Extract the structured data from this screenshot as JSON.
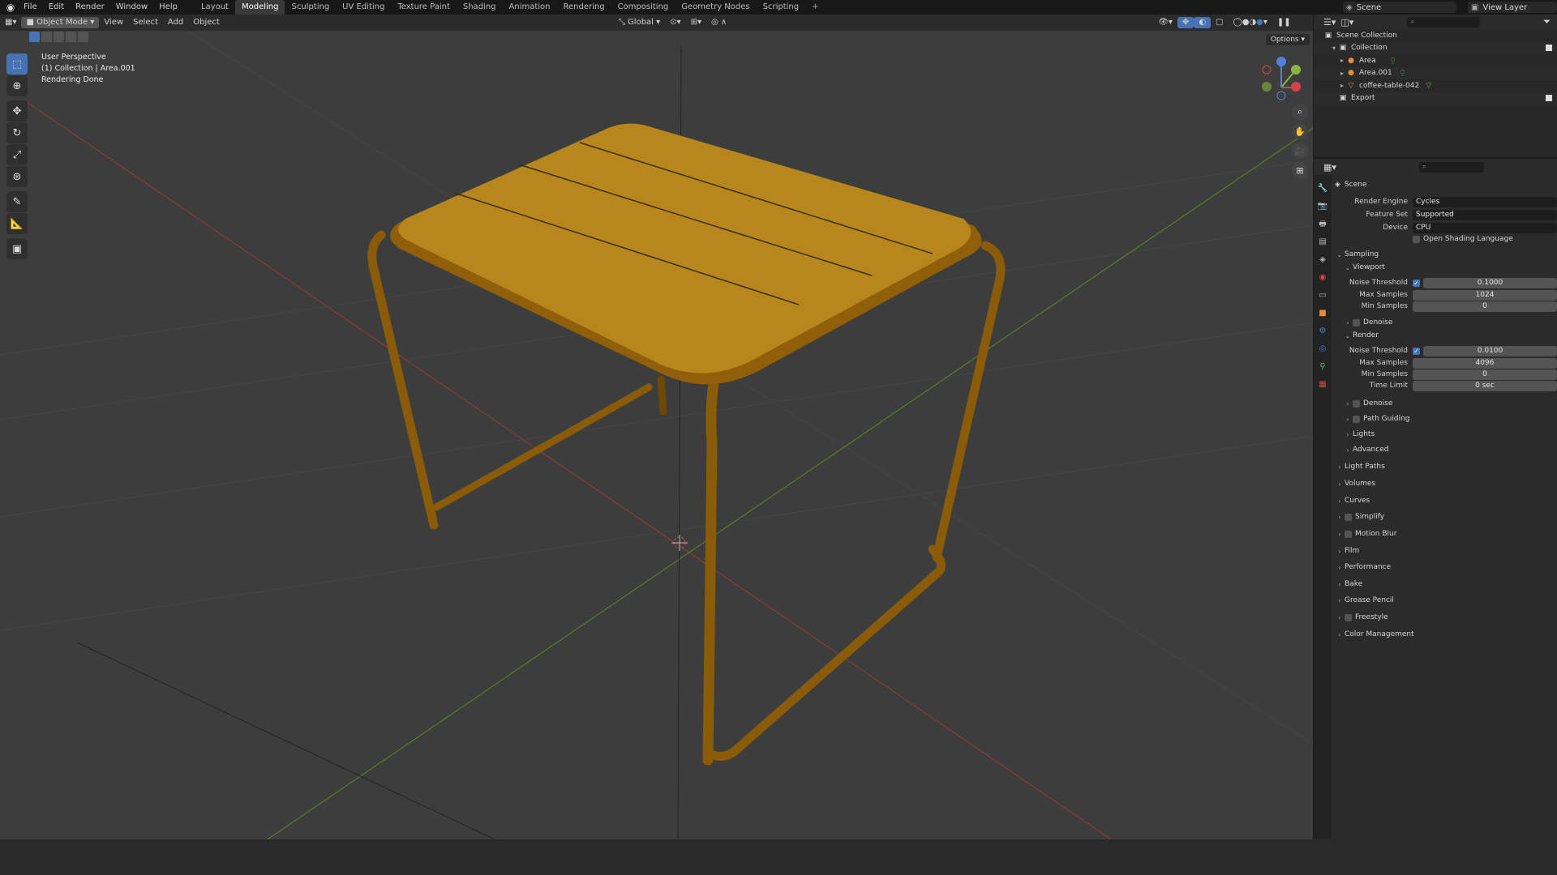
{
  "menu": [
    "File",
    "Edit",
    "Render",
    "Window",
    "Help"
  ],
  "workspaces": [
    "Layout",
    "Modeling",
    "Sculpting",
    "UV Editing",
    "Texture Paint",
    "Shading",
    "Animation",
    "Rendering",
    "Compositing",
    "Geometry Nodes",
    "Scripting"
  ],
  "workspace_active": "Modeling",
  "scene_name": "Scene",
  "view_layer": "View Layer",
  "viewport": {
    "mode": "Object Mode",
    "menus": [
      "View",
      "Select",
      "Add",
      "Object"
    ],
    "orientation": "Global",
    "options": "Options",
    "info": [
      "User Perspective",
      "(1) Collection | Area.001",
      "Rendering Done"
    ]
  },
  "outliner": {
    "search_placeholder": "",
    "rows": [
      {
        "label": "Scene Collection",
        "icon": "scene-collection-icon"
      },
      {
        "label": "Collection",
        "icon": "collection-icon"
      },
      {
        "label": "Area",
        "icon": "light-icon"
      },
      {
        "label": "Area.001",
        "icon": "light-icon"
      },
      {
        "label": "coffee-table-042",
        "icon": "mesh-icon"
      },
      {
        "label": "Export",
        "icon": "collection-icon"
      }
    ]
  },
  "props": {
    "context": "Scene",
    "render_engine_label": "Render Engine",
    "render_engine": "Cycles",
    "feature_set_label": "Feature Set",
    "feature_set": "Supported",
    "device_label": "Device",
    "device": "CPU",
    "osl_label": "Open Shading Language",
    "sampling": "Sampling",
    "viewport": "Viewport",
    "noise_threshold_label": "Noise Threshold",
    "vp_noise_threshold": "0.1000",
    "max_samples_label": "Max Samples",
    "vp_max_samples": "1024",
    "min_samples_label": "Min Samples",
    "vp_min_samples": "0",
    "denoise": "Denoise",
    "render": "Render",
    "r_noise_threshold": "0.0100",
    "r_max_samples": "4096",
    "r_min_samples": "0",
    "time_limit_label": "Time Limit",
    "time_limit": "0 sec",
    "path_guiding": "Path Guiding",
    "lights": "Lights",
    "advanced": "Advanced",
    "sections": [
      "Light Paths",
      "Volumes",
      "Curves",
      "Simplify",
      "Motion Blur",
      "Film",
      "Performance",
      "Bake",
      "Grease Pencil",
      "Freestyle",
      "Color Management"
    ]
  }
}
